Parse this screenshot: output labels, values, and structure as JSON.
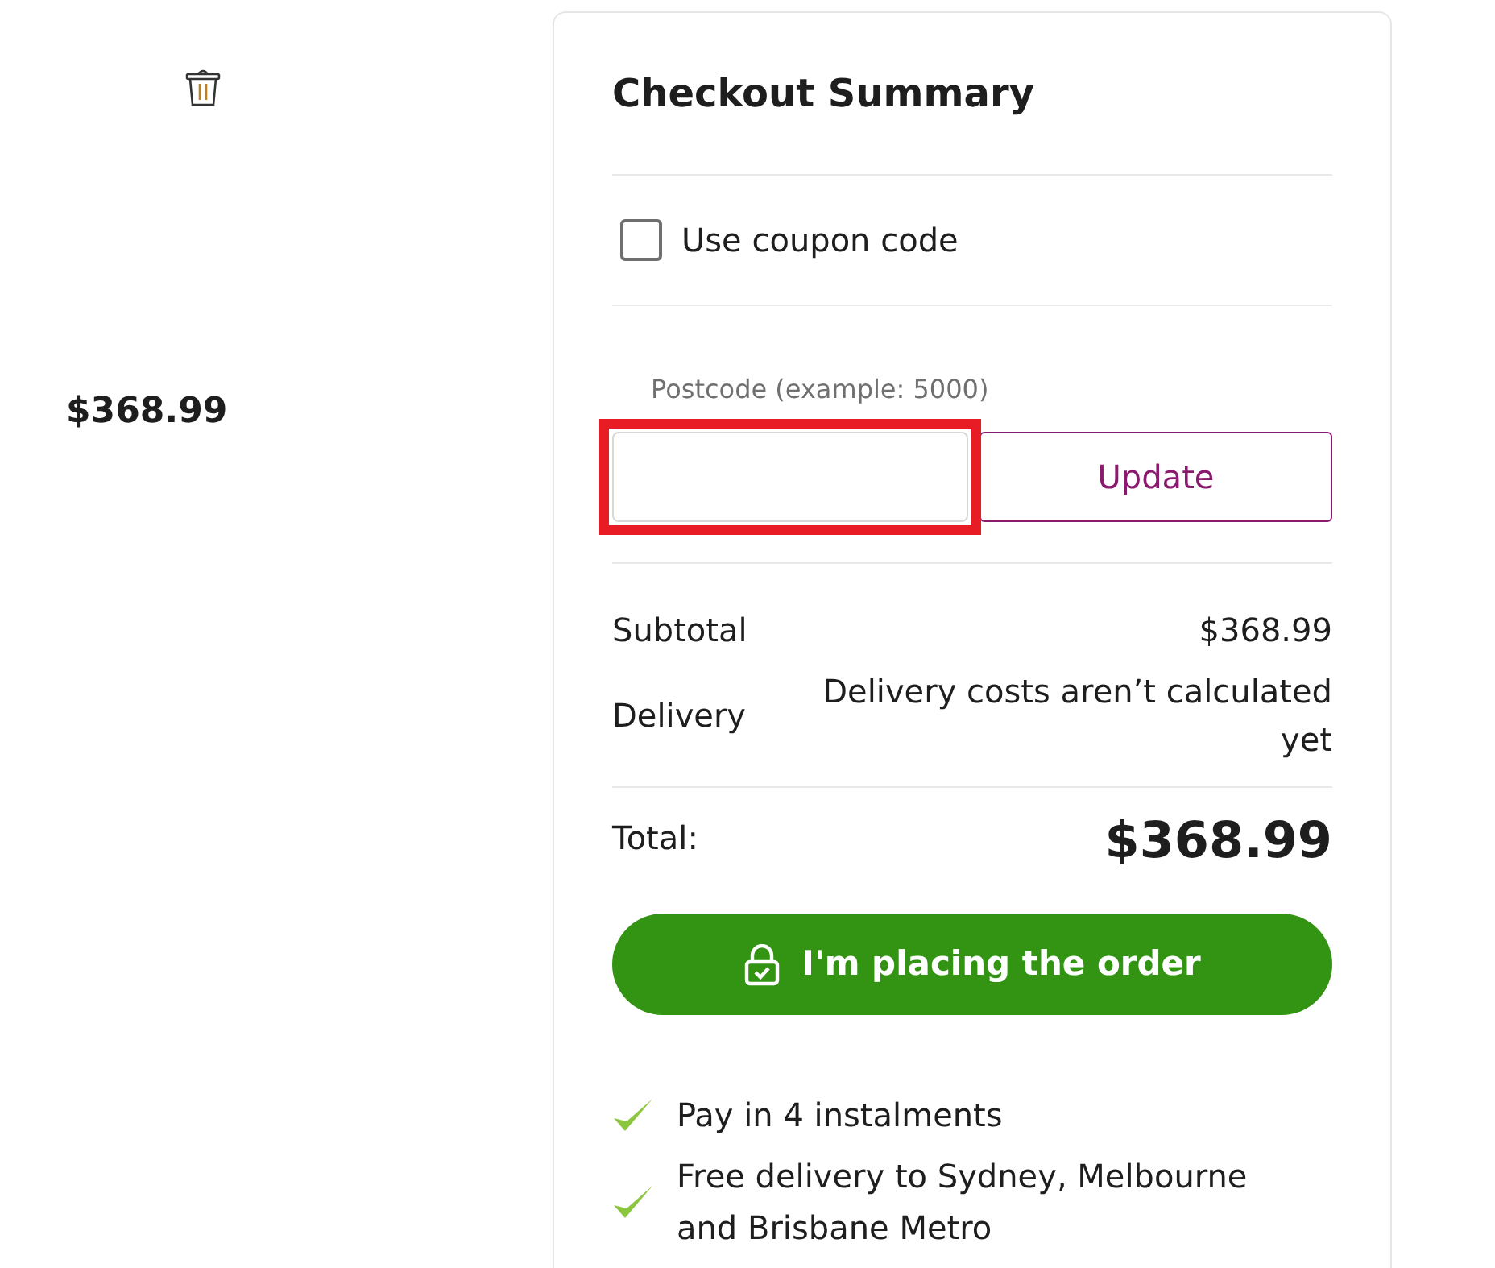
{
  "cart_item": {
    "price": "$368.99"
  },
  "summary": {
    "title": "Checkout Summary",
    "coupon": {
      "label": "Use coupon code",
      "checked": false
    },
    "postcode": {
      "placeholder": "Postcode (example: 5000)",
      "highlighted": true,
      "button": "Update"
    },
    "lines": [
      {
        "label": "Subtotal",
        "value": "$368.99"
      },
      {
        "label": "Delivery",
        "value": "Delivery costs aren’t calculated yet"
      }
    ],
    "total": {
      "label": "Total:",
      "value": "$368.99"
    },
    "order_button": "I'm placing the order",
    "features": [
      "Pay in 4 instalments",
      "Free delivery to Sydney, Melbourne and Brisbane Metro"
    ]
  }
}
